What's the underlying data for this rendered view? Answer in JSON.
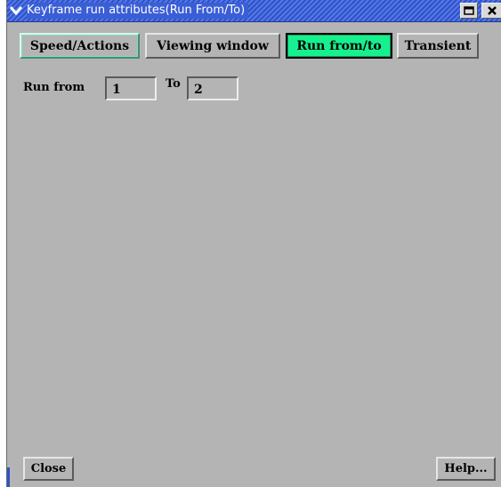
{
  "window": {
    "title": "Keyframe run attributes(Run From/To)",
    "menu_icon": "chevron-down-icon",
    "maximize_icon": "maximize-icon",
    "close_icon": "close-icon",
    "title_color": "#3a5ed6"
  },
  "tabs": [
    {
      "label": "Speed/Actions",
      "active": false
    },
    {
      "label": "Viewing window",
      "active": false
    },
    {
      "label": "Run from/to",
      "active": true
    },
    {
      "label": "Transient",
      "active": false
    }
  ],
  "form": {
    "run_from_label": "Run from",
    "run_from_value": "1",
    "to_label": "To",
    "to_value": "2"
  },
  "buttons": {
    "close_label": "Close",
    "help_label": "Help..."
  },
  "colors": {
    "background": "#b4b4b4",
    "active_tab": "#17f08e",
    "titlebar": "#2f52c8"
  }
}
